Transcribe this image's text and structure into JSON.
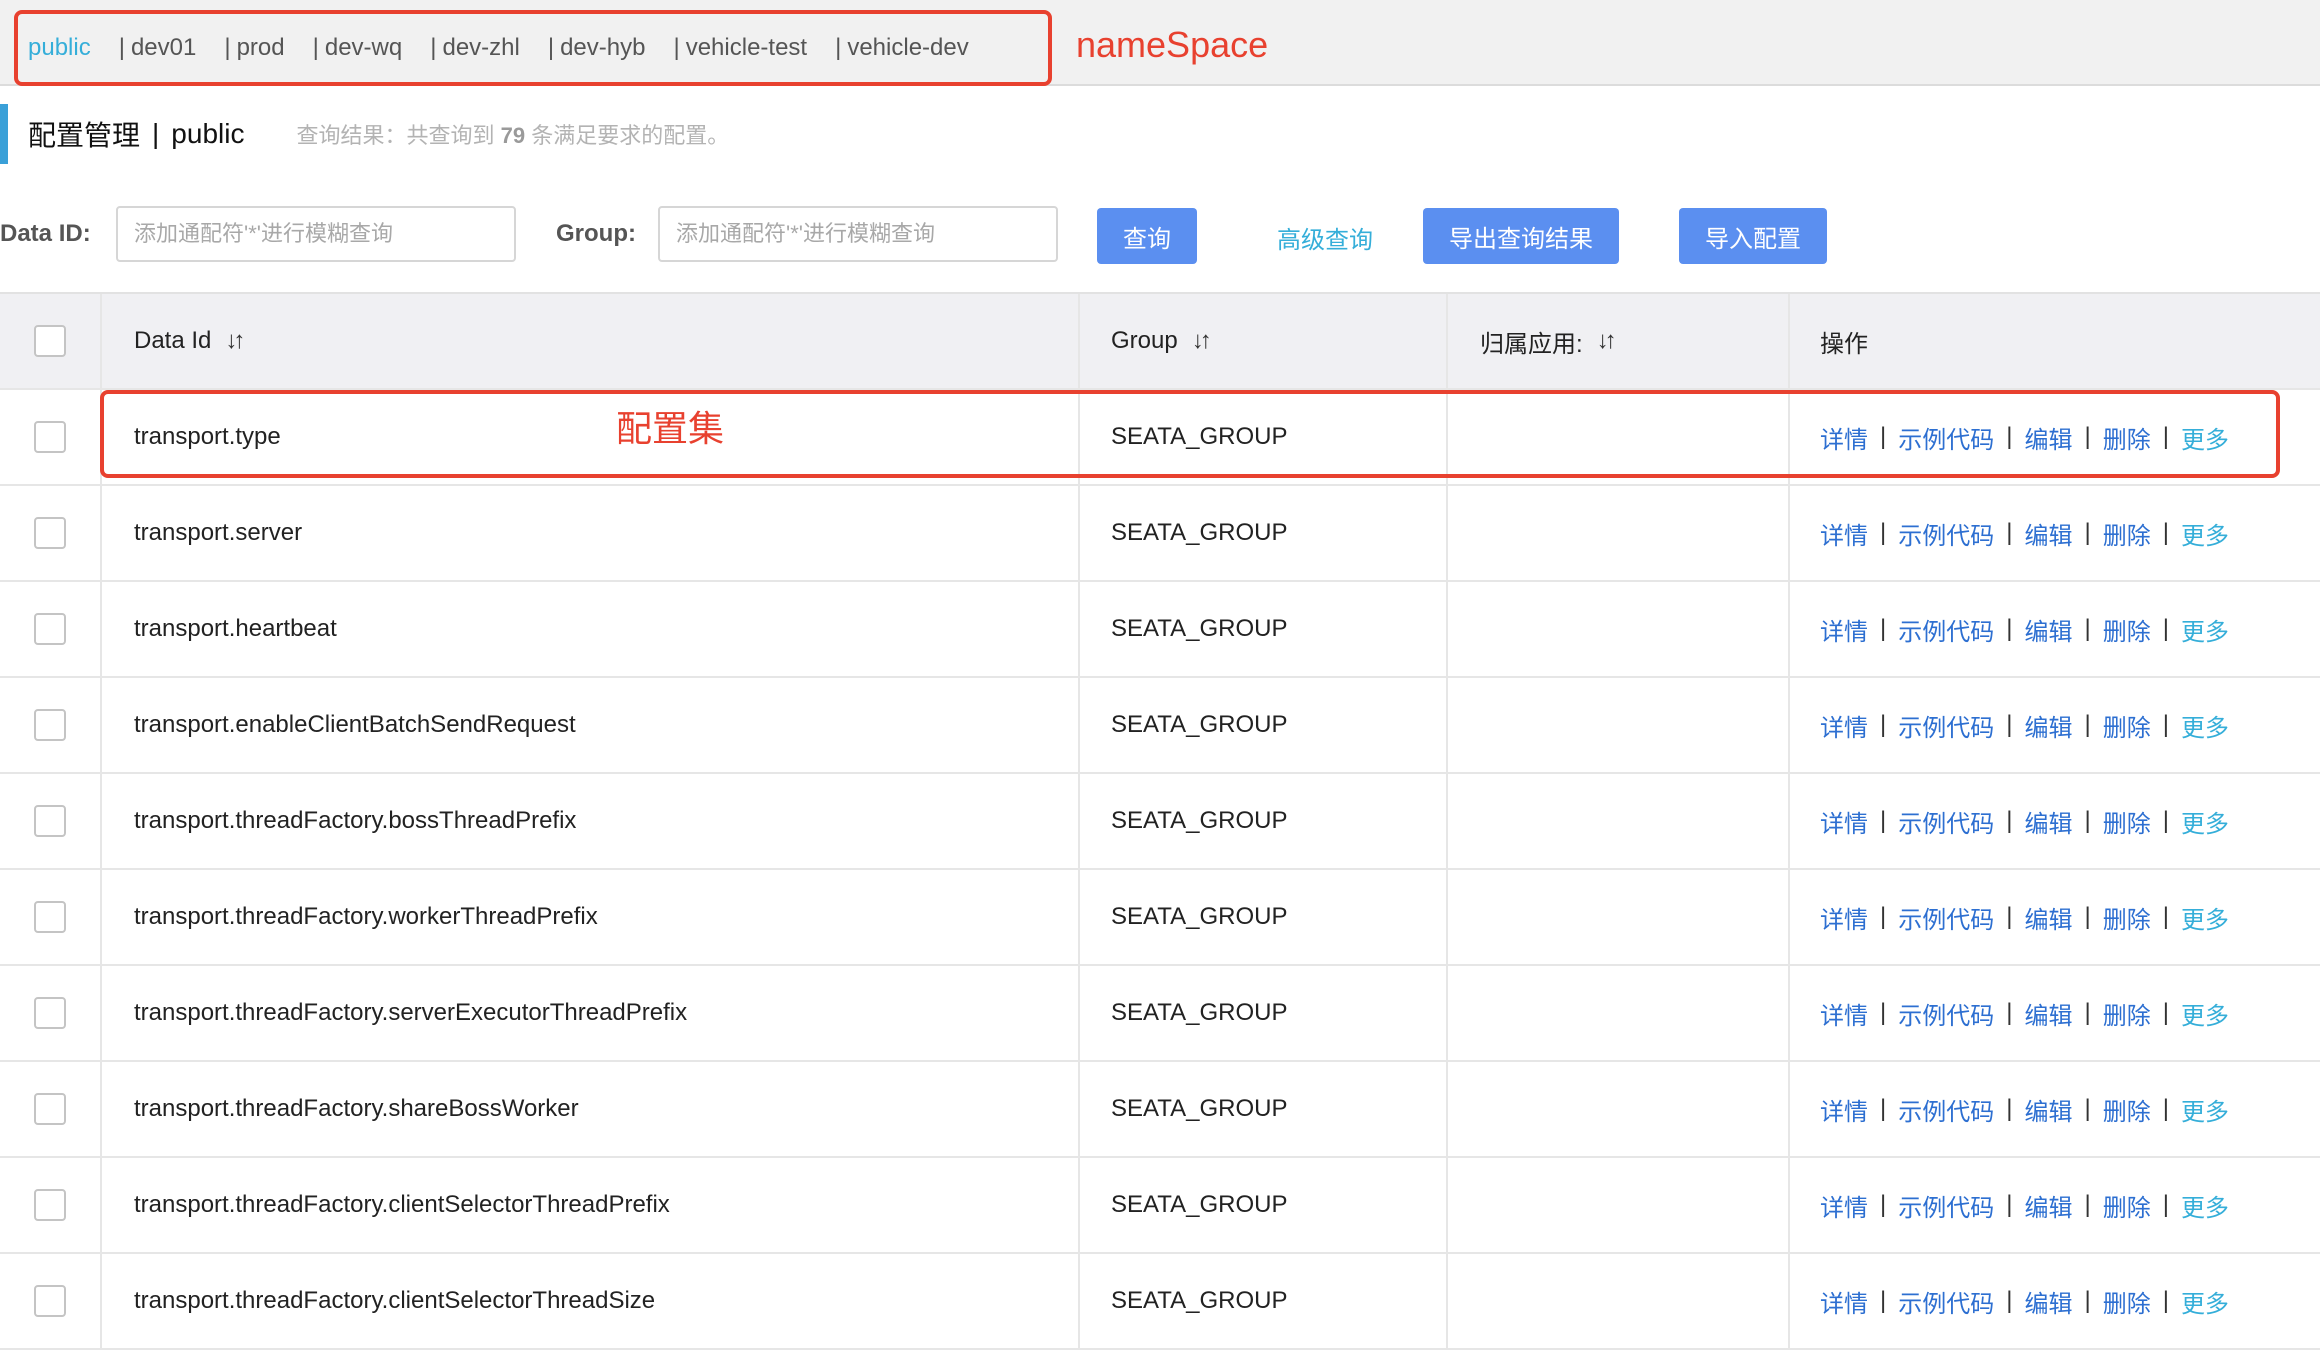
{
  "namespaces": {
    "items": [
      {
        "label": "public",
        "active": true
      },
      {
        "label": "dev01",
        "active": false
      },
      {
        "label": "prod",
        "active": false
      },
      {
        "label": "dev-wq",
        "active": false
      },
      {
        "label": "dev-zhl",
        "active": false
      },
      {
        "label": "dev-hyb",
        "active": false
      },
      {
        "label": "vehicle-test",
        "active": false
      },
      {
        "label": "vehicle-dev",
        "active": false
      }
    ],
    "separator": "|",
    "annotation": "nameSpace"
  },
  "page": {
    "title": "配置管理",
    "title_separator": "|",
    "namespace": "public",
    "query_result_prefix": "查询结果：共查询到",
    "query_result_count": "79",
    "query_result_suffix": "条满足要求的配置。"
  },
  "search": {
    "data_id_label": "Data ID:",
    "data_id_placeholder": "添加通配符'*'进行模糊查询",
    "group_label": "Group:",
    "group_placeholder": "添加通配符'*'进行模糊查询",
    "query_button": "查询",
    "advanced_query": "高级查询",
    "export_button": "导出查询结果",
    "import_button": "导入配置"
  },
  "table": {
    "columns": {
      "data_id": "Data Id",
      "group": "Group",
      "app": "归属应用:",
      "ops": "操作"
    },
    "sort_icon": "↓↑",
    "op_labels": {
      "detail": "详情",
      "sample": "示例代码",
      "edit": "编辑",
      "delete": "删除",
      "more": "更多"
    },
    "rows": [
      {
        "data_id": "transport.type",
        "group": "SEATA_GROUP",
        "app": ""
      },
      {
        "data_id": "transport.server",
        "group": "SEATA_GROUP",
        "app": ""
      },
      {
        "data_id": "transport.heartbeat",
        "group": "SEATA_GROUP",
        "app": ""
      },
      {
        "data_id": "transport.enableClientBatchSendRequest",
        "group": "SEATA_GROUP",
        "app": ""
      },
      {
        "data_id": "transport.threadFactory.bossThreadPrefix",
        "group": "SEATA_GROUP",
        "app": ""
      },
      {
        "data_id": "transport.threadFactory.workerThreadPrefix",
        "group": "SEATA_GROUP",
        "app": ""
      },
      {
        "data_id": "transport.threadFactory.serverExecutorThreadPrefix",
        "group": "SEATA_GROUP",
        "app": ""
      },
      {
        "data_id": "transport.threadFactory.shareBossWorker",
        "group": "SEATA_GROUP",
        "app": ""
      },
      {
        "data_id": "transport.threadFactory.clientSelectorThreadPrefix",
        "group": "SEATA_GROUP",
        "app": ""
      },
      {
        "data_id": "transport.threadFactory.clientSelectorThreadSize",
        "group": "SEATA_GROUP",
        "app": ""
      }
    ],
    "row_annotation": "配置集"
  },
  "colors": {
    "accent": "#5b8ff0",
    "link": "#2d6fd1",
    "active_namespace": "#35aed9",
    "annotation": "#e8412f"
  }
}
